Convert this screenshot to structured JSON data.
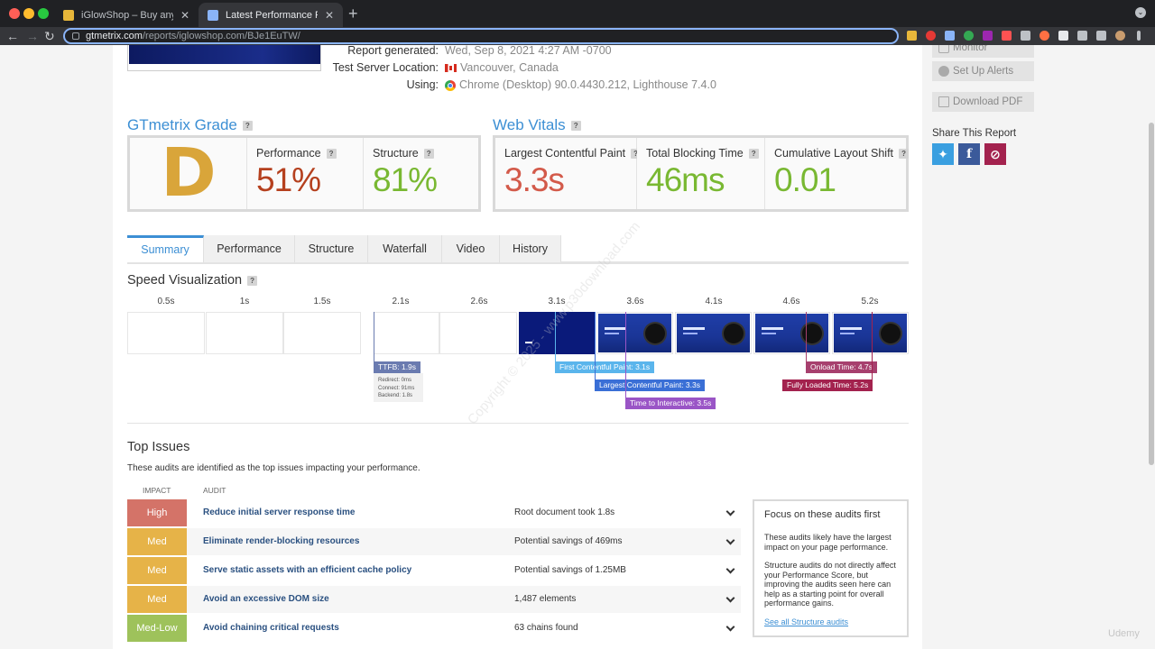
{
  "browser": {
    "tabs": [
      {
        "title": "iGlowShop – Buy anything any",
        "active": false
      },
      {
        "title": "Latest Performance Report for",
        "active": true
      }
    ],
    "new_tab": "+",
    "url_host": "gtmetrix.com",
    "url_path": "/reports/iglowshop.com/BJe1EuTW/"
  },
  "report": {
    "generated_label": "Report generated:",
    "generated_value": "Wed, Sep 8, 2021 4:27 AM -0700",
    "location_label": "Test Server Location:",
    "location_value": "Vancouver, Canada",
    "using_label": "Using:",
    "using_value": "Chrome (Desktop) 90.0.4430.212, Lighthouse 7.4.0"
  },
  "grade": {
    "heading": "GTmetrix Grade",
    "help": "?",
    "letter": "D",
    "performance_label": "Performance",
    "performance_value": "51%",
    "structure_label": "Structure",
    "structure_value": "81%"
  },
  "vitals": {
    "heading": "Web Vitals",
    "lcp_label": "Largest Contentful Paint",
    "lcp_value": "3.3s",
    "tbt_label": "Total Blocking Time",
    "tbt_value": "46ms",
    "cls_label": "Cumulative Layout Shift",
    "cls_value": "0.01"
  },
  "report_tabs": [
    "Summary",
    "Performance",
    "Structure",
    "Waterfall",
    "Video",
    "History"
  ],
  "speed": {
    "heading": "Speed Visualization",
    "ticks": [
      "0.5s",
      "1s",
      "1.5s",
      "2.1s",
      "2.6s",
      "3.1s",
      "3.6s",
      "4.1s",
      "4.6s",
      "5.2s"
    ],
    "ttfb": "TTFB: 1.9s",
    "ttfb_details": [
      "Redirect: 0ms",
      "Connect: 91ms",
      "Backend: 1.8s"
    ],
    "fcp": "First Contentful Paint: 3.1s",
    "lcp": "Largest Contentful Paint: 3.3s",
    "tti": "Time to Interactive: 3.5s",
    "onload": "Onload Time: 4.7s",
    "fully_loaded": "Fully Loaded Time: 5.2s"
  },
  "issues": {
    "heading": "Top Issues",
    "subtitle": "These audits are identified as the top issues impacting your performance.",
    "col_impact": "IMPACT",
    "col_audit": "AUDIT",
    "rows": [
      {
        "impact": "High",
        "audit": "Reduce initial server response time",
        "finding": "Root document took 1.8s"
      },
      {
        "impact": "Med",
        "audit": "Eliminate render-blocking resources",
        "finding": "Potential savings of 469ms"
      },
      {
        "impact": "Med",
        "audit": "Serve static assets with an efficient cache policy",
        "finding": "Potential savings of 1.25MB"
      },
      {
        "impact": "Med",
        "audit": "Avoid an excessive DOM size",
        "finding": "1,487 elements"
      },
      {
        "impact": "Med-Low",
        "audit": "Avoid chaining critical requests",
        "finding": "63 chains found"
      }
    ]
  },
  "focus": {
    "title": "Focus on these audits first",
    "p1": "These audits likely have the largest impact on your page performance.",
    "p2": "Structure audits do not directly affect your Performance Score, but improving the audits seen here can help as a starting point for overall performance gains.",
    "link": "See all Structure audits"
  },
  "sidebar": {
    "monitor": "Monitor",
    "alerts": "Set Up Alerts",
    "pdf": "Download PDF",
    "share_title": "Share This Report"
  },
  "overlay": {
    "watermark": "Copyright © 2025 - www.p30download.com",
    "udemy": "Udemy"
  },
  "colors": {
    "accent": "#3c8fd4",
    "grade_d": "#d9a53a",
    "perf_red": "#b5401e",
    "good_green": "#79b832",
    "warn_red": "#d35a4a",
    "impact_high": "#d47368",
    "impact_med": "#e6b348",
    "impact_medlow": "#9ec25b"
  }
}
